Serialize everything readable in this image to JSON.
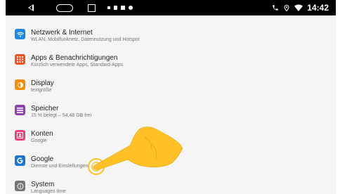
{
  "statusbar": {
    "time": "14:42",
    "nav_icons": [
      "back-icon",
      "home-icon",
      "recents-icon"
    ],
    "status_icons": [
      "phone-icon",
      "location-icon",
      "wifi-icon"
    ]
  },
  "settings": {
    "items": [
      {
        "title": "Netzwerk & Internet",
        "subtitle": "WLAN, Mobilfunknetz, Datennutzung und Hotspot",
        "icon": "wifi-icon",
        "color": "#1E88E5"
      },
      {
        "title": "Apps & Benachrichtigungen",
        "subtitle": "Kürzlich verwendete Apps, Standard-Apps",
        "icon": "apps-icon",
        "color": "#F4511E"
      },
      {
        "title": "Display",
        "subtitle": "textgröße",
        "icon": "brightness-icon",
        "color": "#FB8C00"
      },
      {
        "title": "Speicher",
        "subtitle": "15 % belegt – 54,48 GB frei",
        "icon": "storage-icon",
        "color": "#8E44AD"
      },
      {
        "title": "Konten",
        "subtitle": "Google",
        "icon": "account-icon",
        "color": "#EC407A"
      },
      {
        "title": "Google",
        "subtitle": "Dienste und Einstellungen",
        "icon": "google-icon",
        "color": "#1976D2"
      },
      {
        "title": "System",
        "subtitle": "Languages time",
        "icon": "info-icon",
        "color": "#757575"
      }
    ]
  },
  "overlay": {
    "icon": "pointing-hand-icon",
    "color": "#FFC125"
  }
}
